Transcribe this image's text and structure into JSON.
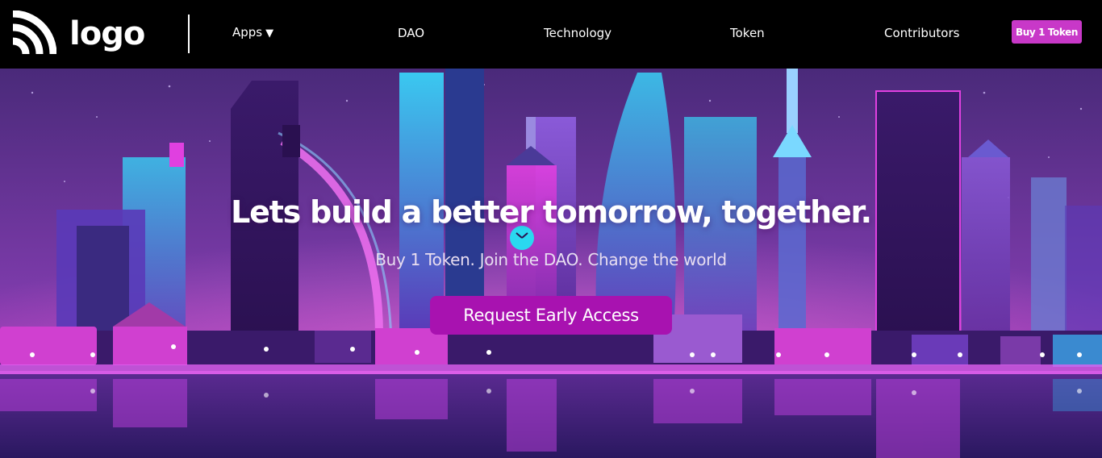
{
  "brand": {
    "logo_text": "logo",
    "logo_icon": "wifi-arcs-icon"
  },
  "nav": {
    "items": [
      {
        "label": "Apps",
        "has_dropdown": true
      },
      {
        "label": "DAO"
      },
      {
        "label": "Technology"
      },
      {
        "label": "Token"
      },
      {
        "label": "Contributors"
      }
    ],
    "dropdown_caret": "▼",
    "buy_button": "Buy 1 Token"
  },
  "hero": {
    "title": "Lets build a better tomorrow, together.",
    "subtitle": "Buy 1 Token. Join the DAO. Change the world",
    "cta": "Request Early Access"
  },
  "colors": {
    "navbar": "#000000",
    "accent": "#c838c8",
    "cta": "#a812b0",
    "sky_top": "#4a2a7a",
    "sky_bottom": "#b03cc0"
  }
}
